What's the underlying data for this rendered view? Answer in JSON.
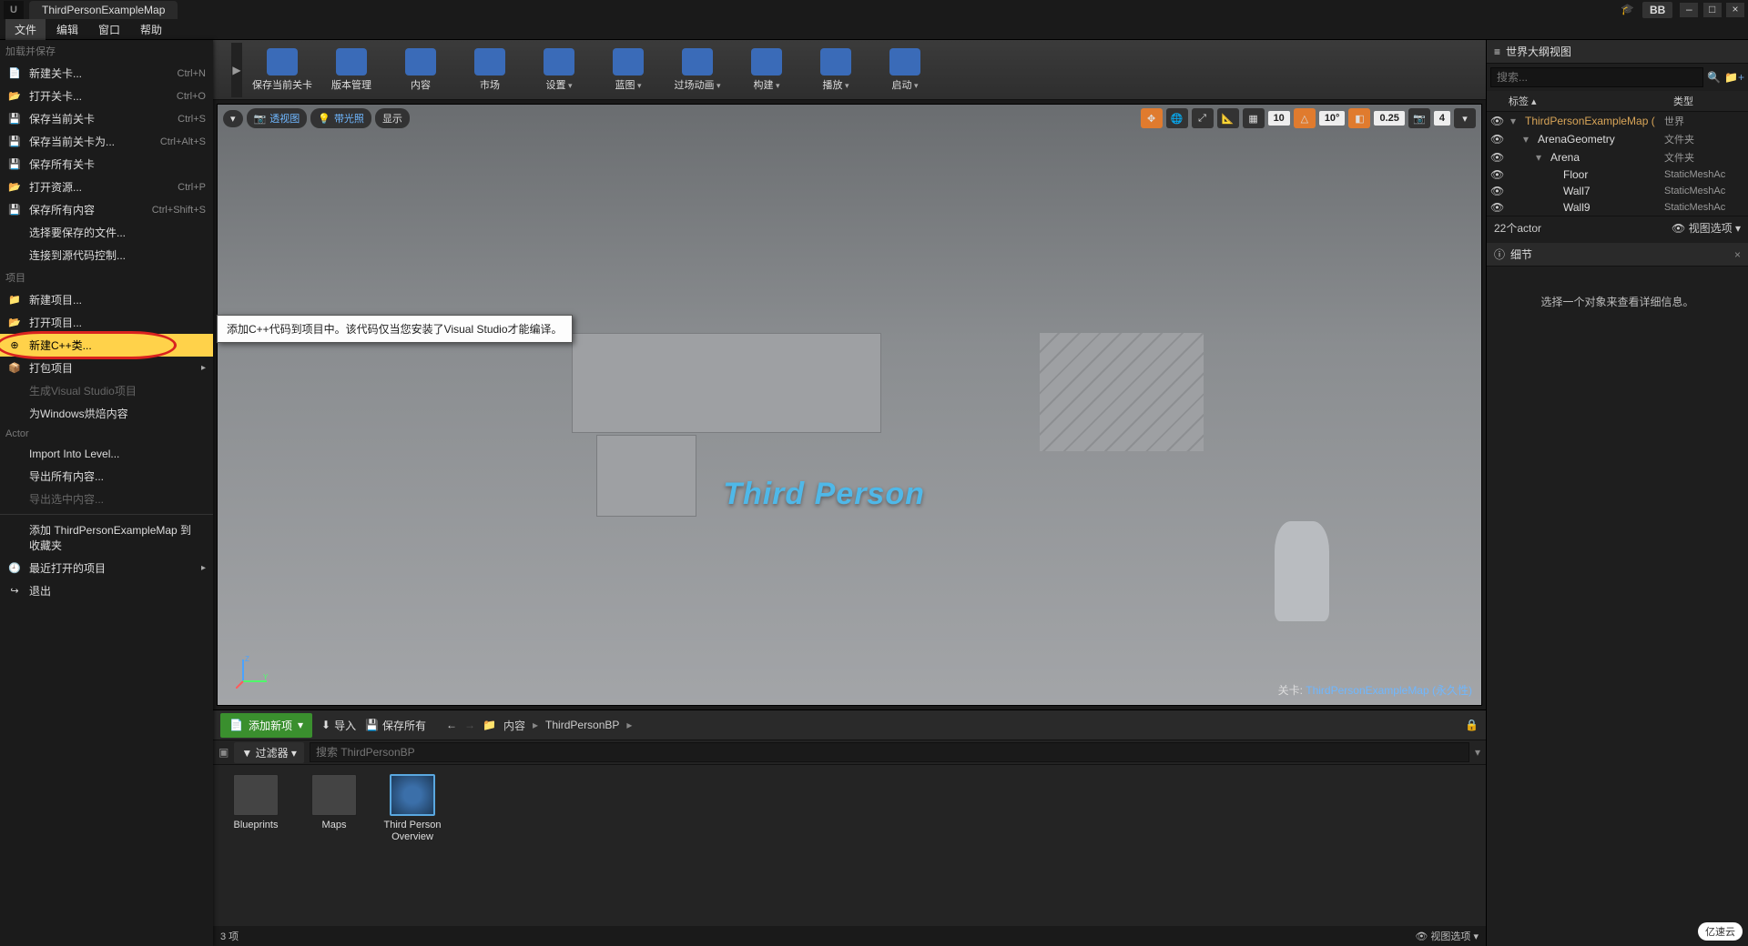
{
  "titlebar": {
    "tab": "ThirdPersonExampleMap",
    "user_badge": "BB"
  },
  "menubar": {
    "items": [
      "文件",
      "编辑",
      "窗口",
      "帮助"
    ]
  },
  "window_controls": [
    "–",
    "□",
    "×"
  ],
  "file_menu": {
    "sections": {
      "load_save": "加载并保存",
      "project": "项目",
      "actor": "Actor"
    },
    "items": [
      {
        "icon": "📄",
        "label": "新建关卡...",
        "short": "Ctrl+N"
      },
      {
        "icon": "📂",
        "label": "打开关卡...",
        "short": "Ctrl+O"
      },
      {
        "icon": "💾",
        "label": "保存当前关卡",
        "short": "Ctrl+S"
      },
      {
        "icon": "💾",
        "label": "保存当前关卡为...",
        "short": "Ctrl+Alt+S"
      },
      {
        "icon": "💾",
        "label": "保存所有关卡",
        "short": ""
      },
      {
        "icon": "📂",
        "label": "打开资源...",
        "short": "Ctrl+P"
      },
      {
        "icon": "💾",
        "label": "保存所有内容",
        "short": "Ctrl+Shift+S"
      },
      {
        "icon": "",
        "label": "选择要保存的文件...",
        "short": ""
      },
      {
        "icon": "",
        "label": "连接到源代码控制...",
        "short": ""
      }
    ],
    "project_items": [
      {
        "icon": "📁",
        "label": "新建项目...",
        "sub": ""
      },
      {
        "icon": "📂",
        "label": "打开项目...",
        "sub": ""
      },
      {
        "icon": "⊕",
        "label": "新建C++类...",
        "sub": "",
        "hl": true
      },
      {
        "icon": "📦",
        "label": "打包项目",
        "sub": "▸"
      },
      {
        "icon": "",
        "label": "生成Visual Studio项目",
        "disabled": true
      },
      {
        "icon": "",
        "label": "为Windows烘焙内容"
      }
    ],
    "actor_items": [
      {
        "label": "Import Into Level..."
      },
      {
        "label": "导出所有内容..."
      },
      {
        "label": "导出选中内容...",
        "disabled": true
      }
    ],
    "extras": [
      {
        "label": "添加 ThirdPersonExampleMap 到收藏夹"
      },
      {
        "icon": "🕘",
        "label": "最近打开的项目",
        "sub": "▸"
      },
      {
        "icon": "↪",
        "label": "退出"
      }
    ]
  },
  "tooltip": "添加C++代码到项目中。该代码仅当您安装了Visual Studio才能编译。",
  "toolbar": {
    "buttons": [
      {
        "label": "保存当前关卡",
        "icon": "ico-save"
      },
      {
        "label": "版本管理",
        "icon": "ico-ver"
      },
      {
        "label": "内容",
        "icon": "ico-content"
      },
      {
        "label": "市场",
        "icon": "ico-market"
      },
      {
        "label": "设置",
        "icon": "ico-settings",
        "dd": true
      },
      {
        "label": "蓝图",
        "icon": "ico-bp",
        "dd": true
      },
      {
        "label": "过场动画",
        "icon": "ico-matinee",
        "dd": true
      },
      {
        "label": "构建",
        "icon": "ico-build",
        "dd": true
      },
      {
        "label": "播放",
        "icon": "ico-play",
        "dd": true
      },
      {
        "label": "启动",
        "icon": "ico-launch",
        "dd": true
      }
    ]
  },
  "viewport": {
    "chips": {
      "perspective": "透视图",
      "lit": "带光照",
      "show": "显示"
    },
    "nums": {
      "grid": "10",
      "angle": "10°",
      "scale": "0.25",
      "cam": "4"
    },
    "scene_text": "Third Person",
    "footer_prefix": "关卡: ",
    "footer_link": "ThirdPersonExampleMap (永久性)"
  },
  "content_browser": {
    "add_new": "添加新项",
    "import": "导入",
    "save_all": "保存所有",
    "crumb_root": "内容",
    "crumb_current": "ThirdPersonBP",
    "filters_label": "过滤器",
    "search_placeholder": "搜索 ThirdPersonBP",
    "assets": [
      {
        "name": "Blueprints",
        "kind": "folder"
      },
      {
        "name": "Maps",
        "kind": "folder"
      },
      {
        "name": "Third Person Overview",
        "kind": "bp"
      }
    ],
    "status_left": "3 项",
    "status_right": "视图选项"
  },
  "outliner": {
    "title": "世界大纲视图",
    "search_placeholder": "搜索...",
    "col_label": "标签",
    "col_type": "类型",
    "rows": [
      {
        "indent": 0,
        "name": "ThirdPersonExampleMap (",
        "type": "世界",
        "link": true
      },
      {
        "indent": 1,
        "name": "ArenaGeometry",
        "type": "文件夹"
      },
      {
        "indent": 2,
        "name": "Arena",
        "type": "文件夹"
      },
      {
        "indent": 3,
        "name": "Floor",
        "type": "StaticMeshAc"
      },
      {
        "indent": 3,
        "name": "Wall7",
        "type": "StaticMeshAc"
      },
      {
        "indent": 3,
        "name": "Wall9",
        "type": "StaticMeshAc"
      }
    ],
    "footer_count": "22个actor",
    "footer_view": "视图选项"
  },
  "details": {
    "title": "细节",
    "empty": "选择一个对象来查看详细信息。"
  },
  "watermark": "亿速云"
}
